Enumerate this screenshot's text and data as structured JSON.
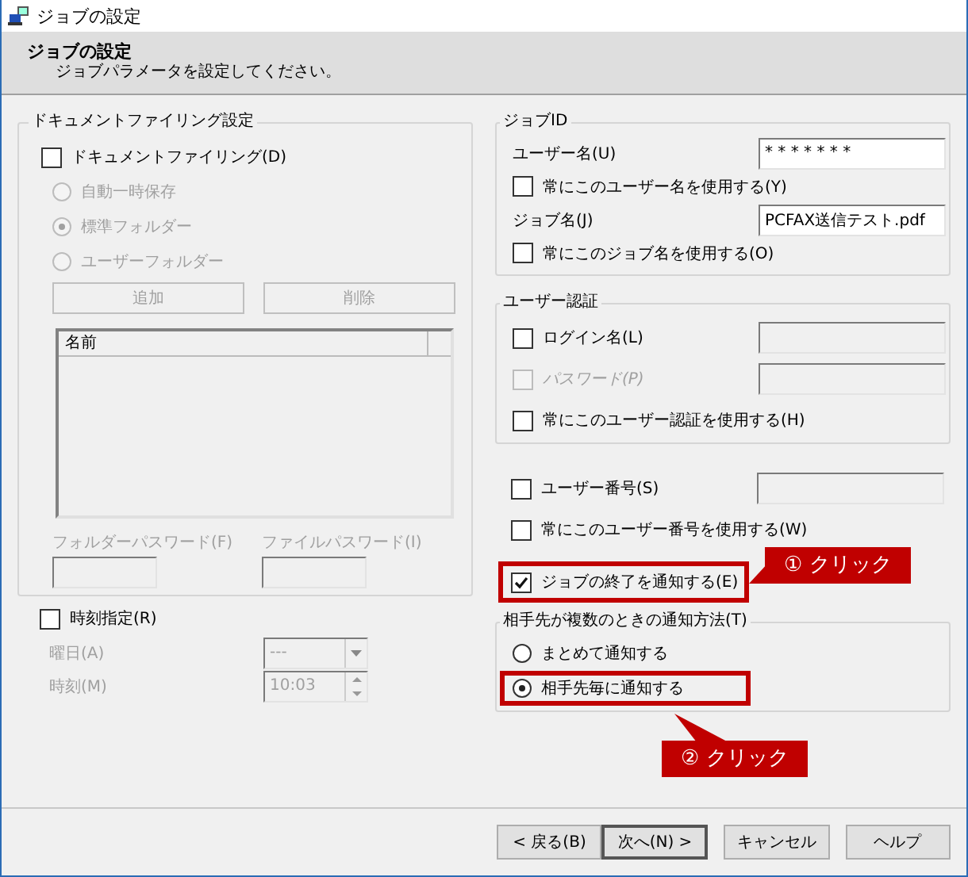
{
  "window": {
    "title": "ジョブの設定"
  },
  "header": {
    "title": "ジョブの設定",
    "subtitle": "ジョブパラメータを設定してください。"
  },
  "document_filing": {
    "title": "ドキュメントファイリング設定",
    "enable": {
      "label": "ドキュメントファイリング(D)",
      "checked": false
    },
    "storage": [
      {
        "kind": "radio",
        "label": "自動一時保存",
        "selected": false,
        "disabled": true
      },
      {
        "kind": "radio",
        "label": "標準フォルダー",
        "selected": true,
        "disabled": true
      },
      {
        "kind": "radio",
        "label": "ユーザーフォルダー",
        "selected": false,
        "disabled": true
      }
    ],
    "buttons": [
      {
        "label": "追加",
        "disabled": true
      },
      {
        "label": "削除",
        "disabled": true
      }
    ],
    "folder_list": {
      "columns": [
        "名前"
      ]
    },
    "passwords": [
      {
        "label": "フォルダーパスワード(F)",
        "disabled": true
      },
      {
        "label": "ファイルパスワード(I)",
        "disabled": true
      }
    ]
  },
  "schedule": {
    "label": "時刻指定(R)",
    "checked": false,
    "fields": [
      {
        "kind": "dropdown",
        "label": "曜日(A)",
        "value": "---",
        "disabled": true
      },
      {
        "kind": "spinner",
        "label": "時刻(M)",
        "value": "10:03",
        "disabled": true
      }
    ]
  },
  "job_id": {
    "title": "ジョブID",
    "rows": [
      {
        "kind": "field",
        "label": "ユーザー名(U)",
        "value": "* * * * * * *"
      },
      {
        "kind": "checkbox",
        "label": "常にこのユーザー名を使用する(Y)",
        "checked": false,
        "disabled": false
      },
      {
        "kind": "field",
        "label": "ジョブ名(J)",
        "value": "PCFAX送信テスト.pdf"
      },
      {
        "kind": "checkbox",
        "label": "常にこのジョブ名を使用する(O)",
        "checked": false,
        "disabled": false
      }
    ]
  },
  "user_auth": {
    "title": "ユーザー認証",
    "rows": [
      {
        "kind": "checkbox",
        "label": "ログイン名(L)",
        "checked": false,
        "disabled": false,
        "field": {
          "disabled": true
        }
      },
      {
        "kind": "checkbox",
        "label": "パスワード(P)",
        "checked": false,
        "disabled": true,
        "field": {
          "disabled": true
        }
      },
      {
        "kind": "checkbox",
        "label": "常にこのユーザー認証を使用する(H)",
        "checked": false,
        "disabled": false
      }
    ]
  },
  "options": {
    "rows": [
      {
        "kind": "checkbox",
        "label": "ユーザー番号(S)",
        "checked": false,
        "disabled": false,
        "field": {
          "disabled": true
        }
      },
      {
        "kind": "checkbox",
        "label": "常にこのユーザー番号を使用する(W)",
        "checked": false,
        "disabled": false
      },
      {
        "kind": "checkbox",
        "label": "ジョブの終了を通知する(E)",
        "checked": true,
        "disabled": false,
        "callout": {
          "text": "① クリック"
        }
      }
    ]
  },
  "notify_method": {
    "title": "相手先が複数のときの通知方法(T)",
    "rows": [
      {
        "kind": "radio",
        "label": "まとめて通知する",
        "selected": false,
        "disabled": false
      },
      {
        "kind": "radio",
        "label": "相手先毎に通知する",
        "selected": true,
        "disabled": false,
        "callout": {
          "text": "② クリック"
        }
      }
    ]
  },
  "buttons": [
    {
      "label": "< 戻る(B)",
      "default": false
    },
    {
      "label": "次へ(N) >",
      "default": true
    },
    {
      "label": "キャンセル",
      "default": false
    },
    {
      "label": "ヘルプ",
      "default": false
    }
  ]
}
